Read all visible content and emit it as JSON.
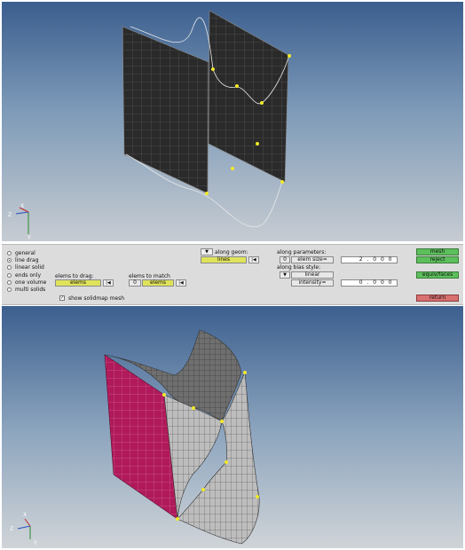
{
  "options": {
    "items": [
      {
        "label": "general",
        "selected": false
      },
      {
        "label": "line drag",
        "selected": true
      },
      {
        "label": "linear solid",
        "selected": false
      },
      {
        "label": "ends only",
        "selected": false
      },
      {
        "label": "one volume",
        "selected": false
      },
      {
        "label": "multi solids",
        "selected": false
      }
    ]
  },
  "drag": {
    "elems_to_drag_label": "elems to drag:",
    "elems_to_drag_btn": "elems",
    "elems_to_match_label": "elems to match",
    "elems_to_match_btn": "elems",
    "elems_to_match_prefix": "0"
  },
  "geom": {
    "along_geom_label": "along geom:",
    "along_geom_btn": "lines"
  },
  "params": {
    "along_parameters_label": "along parameters:",
    "elem_size_prefix": "0",
    "elem_size_label": "elem size=",
    "elem_size_value": "2.000",
    "bias_style_label": "along bias style:",
    "bias_style_value": "linear",
    "intensity_label": "intensity=",
    "intensity_value": "0.000"
  },
  "checkbox": {
    "label": "show solidmap mesh",
    "checked": true
  },
  "buttons": {
    "mesh": "mesh",
    "reject": "reject",
    "equiv": "equiv/faces",
    "return": "return"
  },
  "colors": {
    "green_button": "#5cbf5c",
    "red_button": "#d87070",
    "yellow_button": "#dfe35a",
    "node_yellow": "#f2ea2a",
    "element_dark": "#2a2a2a",
    "element_magenta": "#b01a5a",
    "element_grey": "#bdbdbd"
  },
  "triads": [
    {
      "x_label": "X",
      "y_label": "Y",
      "z_label": "Z"
    },
    {
      "x_label": "X",
      "y_label": "Y",
      "z_label": "Z"
    }
  ]
}
